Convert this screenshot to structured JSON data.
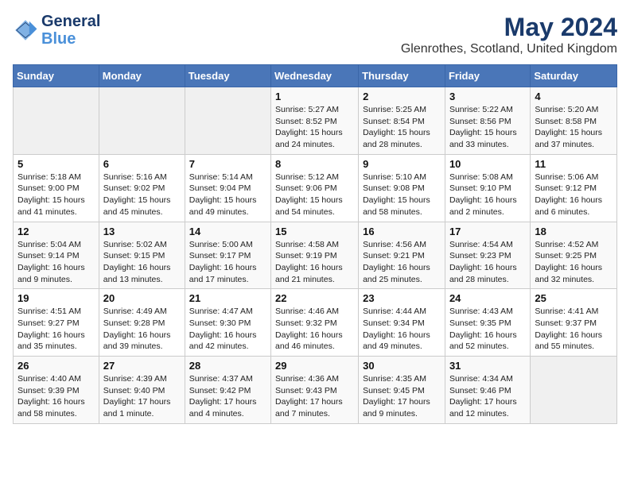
{
  "header": {
    "logo_line1": "General",
    "logo_line2": "Blue",
    "main_title": "May 2024",
    "subtitle": "Glenrothes, Scotland, United Kingdom"
  },
  "days_of_week": [
    "Sunday",
    "Monday",
    "Tuesday",
    "Wednesday",
    "Thursday",
    "Friday",
    "Saturday"
  ],
  "weeks": [
    [
      {
        "day": "",
        "info": ""
      },
      {
        "day": "",
        "info": ""
      },
      {
        "day": "",
        "info": ""
      },
      {
        "day": "1",
        "info": "Sunrise: 5:27 AM\nSunset: 8:52 PM\nDaylight: 15 hours and 24 minutes."
      },
      {
        "day": "2",
        "info": "Sunrise: 5:25 AM\nSunset: 8:54 PM\nDaylight: 15 hours and 28 minutes."
      },
      {
        "day": "3",
        "info": "Sunrise: 5:22 AM\nSunset: 8:56 PM\nDaylight: 15 hours and 33 minutes."
      },
      {
        "day": "4",
        "info": "Sunrise: 5:20 AM\nSunset: 8:58 PM\nDaylight: 15 hours and 37 minutes."
      }
    ],
    [
      {
        "day": "5",
        "info": "Sunrise: 5:18 AM\nSunset: 9:00 PM\nDaylight: 15 hours and 41 minutes."
      },
      {
        "day": "6",
        "info": "Sunrise: 5:16 AM\nSunset: 9:02 PM\nDaylight: 15 hours and 45 minutes."
      },
      {
        "day": "7",
        "info": "Sunrise: 5:14 AM\nSunset: 9:04 PM\nDaylight: 15 hours and 49 minutes."
      },
      {
        "day": "8",
        "info": "Sunrise: 5:12 AM\nSunset: 9:06 PM\nDaylight: 15 hours and 54 minutes."
      },
      {
        "day": "9",
        "info": "Sunrise: 5:10 AM\nSunset: 9:08 PM\nDaylight: 15 hours and 58 minutes."
      },
      {
        "day": "10",
        "info": "Sunrise: 5:08 AM\nSunset: 9:10 PM\nDaylight: 16 hours and 2 minutes."
      },
      {
        "day": "11",
        "info": "Sunrise: 5:06 AM\nSunset: 9:12 PM\nDaylight: 16 hours and 6 minutes."
      }
    ],
    [
      {
        "day": "12",
        "info": "Sunrise: 5:04 AM\nSunset: 9:14 PM\nDaylight: 16 hours and 9 minutes."
      },
      {
        "day": "13",
        "info": "Sunrise: 5:02 AM\nSunset: 9:15 PM\nDaylight: 16 hours and 13 minutes."
      },
      {
        "day": "14",
        "info": "Sunrise: 5:00 AM\nSunset: 9:17 PM\nDaylight: 16 hours and 17 minutes."
      },
      {
        "day": "15",
        "info": "Sunrise: 4:58 AM\nSunset: 9:19 PM\nDaylight: 16 hours and 21 minutes."
      },
      {
        "day": "16",
        "info": "Sunrise: 4:56 AM\nSunset: 9:21 PM\nDaylight: 16 hours and 25 minutes."
      },
      {
        "day": "17",
        "info": "Sunrise: 4:54 AM\nSunset: 9:23 PM\nDaylight: 16 hours and 28 minutes."
      },
      {
        "day": "18",
        "info": "Sunrise: 4:52 AM\nSunset: 9:25 PM\nDaylight: 16 hours and 32 minutes."
      }
    ],
    [
      {
        "day": "19",
        "info": "Sunrise: 4:51 AM\nSunset: 9:27 PM\nDaylight: 16 hours and 35 minutes."
      },
      {
        "day": "20",
        "info": "Sunrise: 4:49 AM\nSunset: 9:28 PM\nDaylight: 16 hours and 39 minutes."
      },
      {
        "day": "21",
        "info": "Sunrise: 4:47 AM\nSunset: 9:30 PM\nDaylight: 16 hours and 42 minutes."
      },
      {
        "day": "22",
        "info": "Sunrise: 4:46 AM\nSunset: 9:32 PM\nDaylight: 16 hours and 46 minutes."
      },
      {
        "day": "23",
        "info": "Sunrise: 4:44 AM\nSunset: 9:34 PM\nDaylight: 16 hours and 49 minutes."
      },
      {
        "day": "24",
        "info": "Sunrise: 4:43 AM\nSunset: 9:35 PM\nDaylight: 16 hours and 52 minutes."
      },
      {
        "day": "25",
        "info": "Sunrise: 4:41 AM\nSunset: 9:37 PM\nDaylight: 16 hours and 55 minutes."
      }
    ],
    [
      {
        "day": "26",
        "info": "Sunrise: 4:40 AM\nSunset: 9:39 PM\nDaylight: 16 hours and 58 minutes."
      },
      {
        "day": "27",
        "info": "Sunrise: 4:39 AM\nSunset: 9:40 PM\nDaylight: 17 hours and 1 minute."
      },
      {
        "day": "28",
        "info": "Sunrise: 4:37 AM\nSunset: 9:42 PM\nDaylight: 17 hours and 4 minutes."
      },
      {
        "day": "29",
        "info": "Sunrise: 4:36 AM\nSunset: 9:43 PM\nDaylight: 17 hours and 7 minutes."
      },
      {
        "day": "30",
        "info": "Sunrise: 4:35 AM\nSunset: 9:45 PM\nDaylight: 17 hours and 9 minutes."
      },
      {
        "day": "31",
        "info": "Sunrise: 4:34 AM\nSunset: 9:46 PM\nDaylight: 17 hours and 12 minutes."
      },
      {
        "day": "",
        "info": ""
      }
    ]
  ]
}
